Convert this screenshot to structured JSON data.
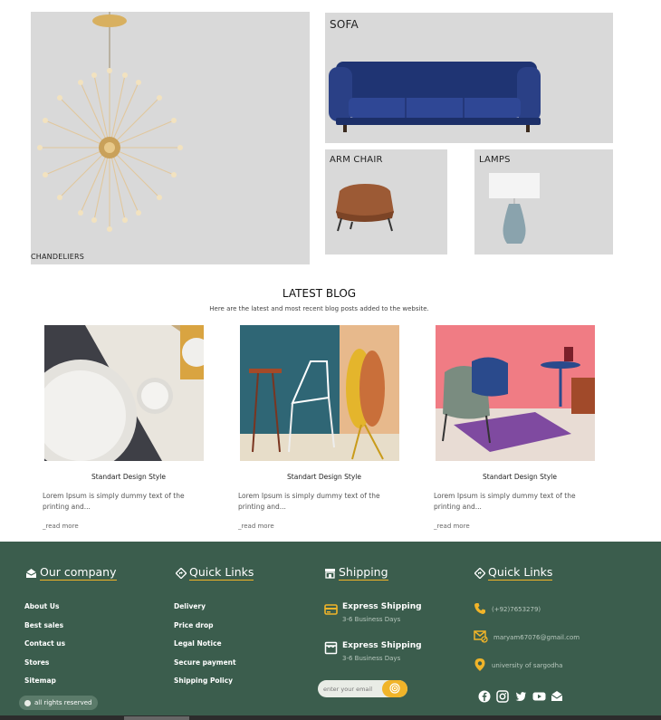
{
  "categories": {
    "chandeliers": "CHANDELIERS",
    "sofa": "SOFA",
    "arm_chair": "ARM CHAIR",
    "lamps": "LAMPS"
  },
  "blog": {
    "title": "LATEST BLOG",
    "subtitle": "Here are the latest and most recent blog posts added to the website.",
    "posts": [
      {
        "heading": "Standart Design Style",
        "text": "Lorem Ipsum is simply dummy text of the printing and...",
        "more": "_read more"
      },
      {
        "heading": "Standart Design Style",
        "text": "Lorem Ipsum is simply dummy text of the printing and...",
        "more": "_read more"
      },
      {
        "heading": "Standart Design Style",
        "text": "Lorem Ipsum is simply dummy text of the printing and...",
        "more": "_read more"
      }
    ]
  },
  "footer": {
    "company": {
      "title": "Our company",
      "items": [
        "About Us",
        "Best sales",
        "Contact us",
        "Stores",
        "Sitemap"
      ]
    },
    "quick_links": {
      "title": "Quick Links",
      "items": [
        "Delivery",
        "Price drop",
        "Legal Notice",
        "Secure payment",
        "Shipping Policy"
      ]
    },
    "shipping": {
      "title": "Shipping",
      "items": [
        {
          "title": "Express Shipping",
          "days": "3-6 Business Days"
        },
        {
          "title": "Express Shipping",
          "days": "3-6 Business Days"
        }
      ],
      "email_placeholder": "enter your email"
    },
    "contact": {
      "title": "Quick Links",
      "phone": "(+92)7653279)",
      "email": "maryam67076@gmail.com",
      "address": "university of sargodha"
    },
    "socials": [
      "facebook-icon",
      "instagram-icon",
      "twitter-icon",
      "youtube-icon",
      "mail-icon"
    ],
    "rights": "all rights reserved"
  },
  "colors": {
    "footer_bg": "#3b5d4d",
    "accent": "#f0b429",
    "card_bg": "#d9d9d9"
  }
}
